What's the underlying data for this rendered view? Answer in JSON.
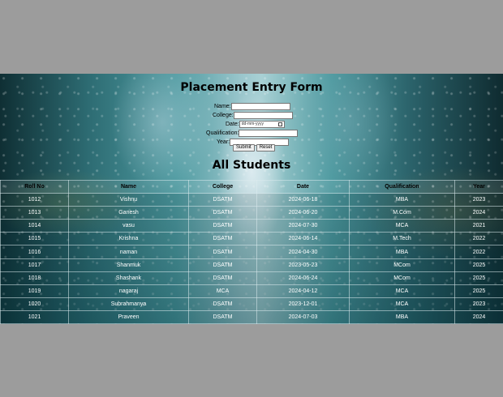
{
  "form": {
    "title": "Placement Entry Form",
    "fields": {
      "name": {
        "label": "Name:",
        "value": ""
      },
      "college": {
        "label": "College:",
        "value": ""
      },
      "date": {
        "label": "Date:",
        "placeholder": "dd-mm-yyyy"
      },
      "qualification": {
        "label": "Qualification:",
        "value": ""
      },
      "year": {
        "label": "Year:",
        "value": ""
      }
    },
    "submit_label": "Submit",
    "reset_label": "Reset"
  },
  "list": {
    "title": "All Students",
    "columns": [
      "Roll No",
      "Name",
      "College",
      "Date",
      "Qualification",
      "Year"
    ],
    "rows": [
      [
        "1012",
        "Vishnu",
        "DSATM",
        "2024-06-18",
        "MBA",
        "2023"
      ],
      [
        "1013",
        "Ganesh",
        "DSATM",
        "2024-06-20",
        "M.Com",
        "2024"
      ],
      [
        "1014",
        "vasu",
        "DSATM",
        "2024-07-30",
        "MCA",
        "2021"
      ],
      [
        "1015",
        "Krishna",
        "DSATM",
        "2024-06-14",
        "M.Tech",
        "2022"
      ],
      [
        "1016",
        "naman",
        "DSATM",
        "2024-04-30",
        "MBA",
        "2022"
      ],
      [
        "1017",
        "Shanmuk",
        "DSATM",
        "2023-05-23",
        "MCom",
        "2025"
      ],
      [
        "1018",
        "Shashank",
        "DSATM",
        "2024-06-24",
        "MCom",
        "2025"
      ],
      [
        "1019",
        "nagaraj",
        "MCA",
        "2024-04-12",
        "MCA",
        "2025"
      ],
      [
        "1020",
        "Subrahmanya",
        "DSATM",
        "2023-12-01",
        "MCA",
        "2023"
      ],
      [
        "1021",
        "Praveen",
        "DSATM",
        "2024-07-03",
        "MBA",
        "2024"
      ]
    ]
  },
  "colors": {
    "outer_background": "#9c9c9c",
    "table_text": "#ffffff"
  },
  "icons": {
    "date_picker": "calendar-icon"
  }
}
